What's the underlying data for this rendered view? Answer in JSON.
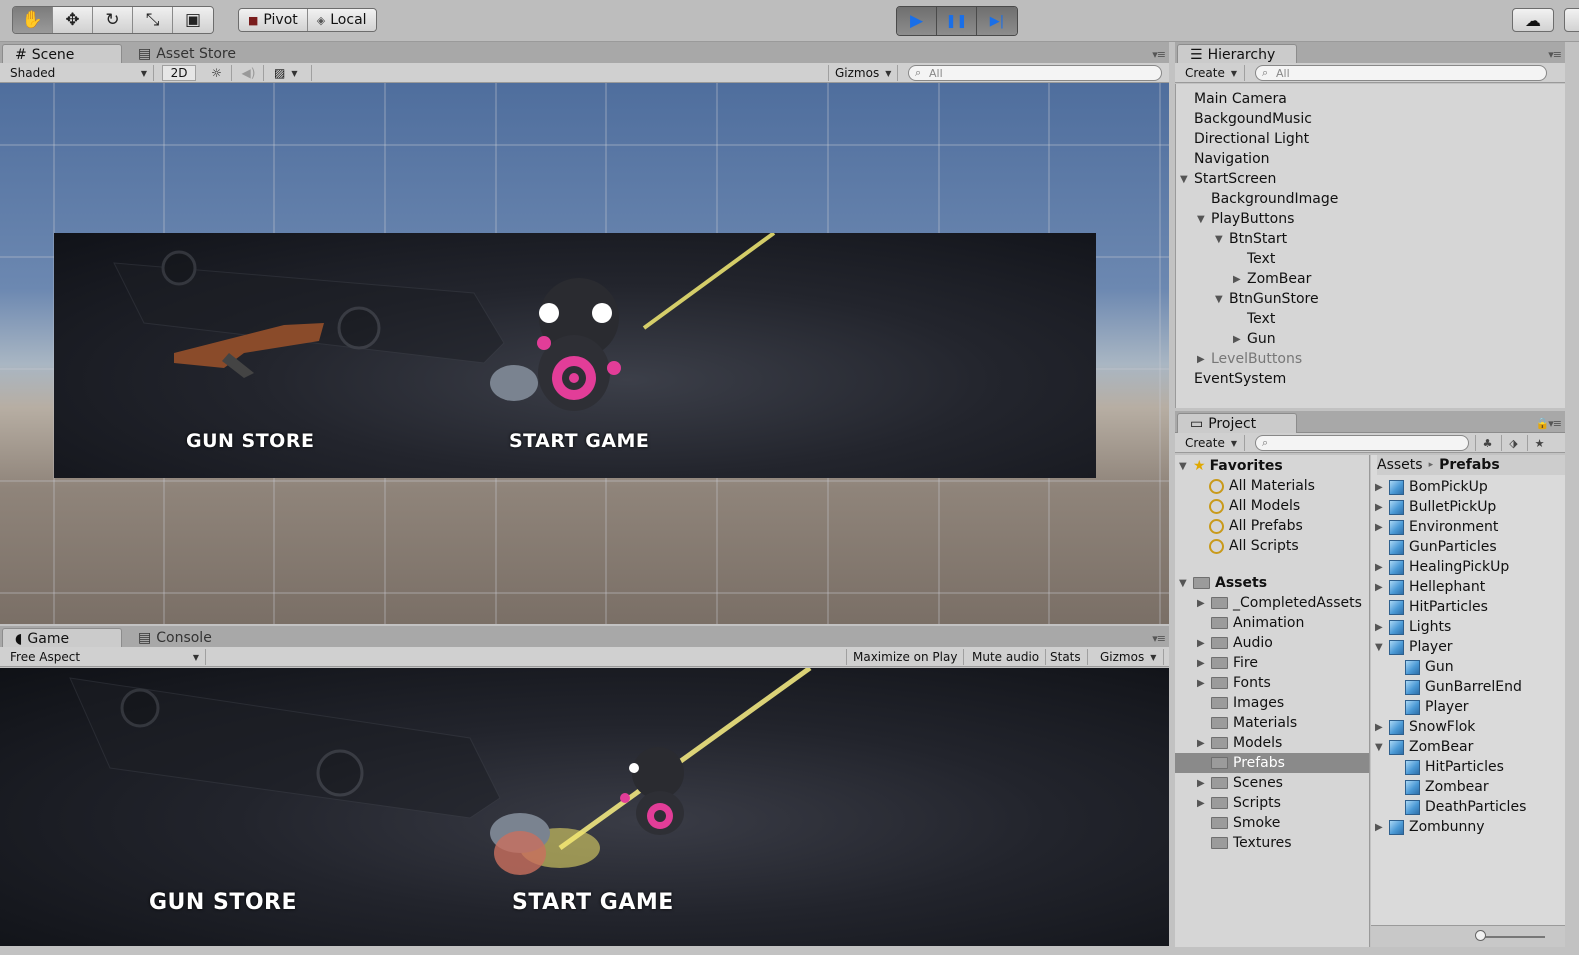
{
  "toolbar": {
    "tools": [
      {
        "name": "hand-tool",
        "glyph": "✋"
      },
      {
        "name": "move-tool",
        "glyph": "✥"
      },
      {
        "name": "rotate-tool",
        "glyph": "↻"
      },
      {
        "name": "scale-tool",
        "glyph": "⤡"
      },
      {
        "name": "rect-tool",
        "glyph": "▣"
      }
    ],
    "pivot_label": "Pivot",
    "local_label": "Local",
    "play_glyph": "▶",
    "pause_glyph": "❚❚",
    "step_glyph": "▶|",
    "cloud_glyph": "☁"
  },
  "scene": {
    "tab_label": "Scene",
    "asset_store_label": "Asset Store",
    "shading_mode": "Shaded",
    "mode_2d": "2D",
    "gizmos_label": "Gizmos",
    "search_placeholder": "All"
  },
  "game": {
    "tab_label": "Game",
    "console_label": "Console",
    "aspect": "Free Aspect",
    "maximize_label": "Maximize on Play",
    "mute_label": "Mute audio",
    "stats_label": "Stats",
    "gizmos_label": "Gizmos"
  },
  "canvas_labels": {
    "gun_store": "GUN STORE",
    "start_game": "START GAME"
  },
  "hierarchy": {
    "tab_label": "Hierarchy",
    "create_label": "Create",
    "search_placeholder": "All",
    "items": [
      {
        "label": "Main Camera",
        "expander": ""
      },
      {
        "label": "BackgoundMusic",
        "expander": ""
      },
      {
        "label": "Directional Light",
        "expander": ""
      },
      {
        "label": "Navigation",
        "expander": ""
      },
      {
        "label": "StartScreen",
        "expander": "▼"
      },
      {
        "label": "BackgroundImage",
        "expander": ""
      },
      {
        "label": "PlayButtons",
        "expander": "▼"
      },
      {
        "label": "BtnStart",
        "expander": "▼"
      },
      {
        "label": "Text",
        "expander": ""
      },
      {
        "label": "ZomBear",
        "expander": "▶"
      },
      {
        "label": "BtnGunStore",
        "expander": "▼"
      },
      {
        "label": "Text",
        "expander": ""
      },
      {
        "label": "Gun",
        "expander": "▶"
      },
      {
        "label": "LevelButtons",
        "expander": "▶"
      },
      {
        "label": "EventSystem",
        "expander": ""
      }
    ]
  },
  "project": {
    "tab_label": "Project",
    "create_label": "Create",
    "favorites_label": "Favorites",
    "favorites": [
      "All Materials",
      "All Models",
      "All Prefabs",
      "All Scripts"
    ],
    "assets_label": "Assets",
    "folders": [
      {
        "label": "_CompletedAssets",
        "expander": "▶"
      },
      {
        "label": "Animation",
        "expander": ""
      },
      {
        "label": "Audio",
        "expander": "▶"
      },
      {
        "label": "Fire",
        "expander": "▶"
      },
      {
        "label": "Fonts",
        "expander": "▶"
      },
      {
        "label": "Images",
        "expander": ""
      },
      {
        "label": "Materials",
        "expander": ""
      },
      {
        "label": "Models",
        "expander": "▶"
      },
      {
        "label": "Prefabs",
        "expander": ""
      },
      {
        "label": "Scenes",
        "expander": "▶"
      },
      {
        "label": "Scripts",
        "expander": "▶"
      },
      {
        "label": "Smoke",
        "expander": ""
      },
      {
        "label": "Textures",
        "expander": ""
      }
    ],
    "breadcrumb_root": "Assets",
    "breadcrumb_sep": "▸",
    "breadcrumb_current": "Prefabs",
    "prefabs": [
      {
        "label": "BomPickUp",
        "expander": "▶"
      },
      {
        "label": "BulletPickUp",
        "expander": "▶"
      },
      {
        "label": "Environment",
        "expander": "▶"
      },
      {
        "label": "GunParticles",
        "expander": ""
      },
      {
        "label": "HealingPickUp",
        "expander": "▶"
      },
      {
        "label": "Hellephant",
        "expander": "▶"
      },
      {
        "label": "HitParticles",
        "expander": ""
      },
      {
        "label": "Lights",
        "expander": "▶"
      },
      {
        "label": "Player",
        "expander": "▼"
      },
      {
        "label": "Gun",
        "expander": ""
      },
      {
        "label": "GunBarrelEnd",
        "expander": ""
      },
      {
        "label": "Player",
        "expander": ""
      },
      {
        "label": "SnowFlok",
        "expander": "▶"
      },
      {
        "label": "ZomBear",
        "expander": "▼"
      },
      {
        "label": "HitParticles",
        "expander": ""
      },
      {
        "label": "Zombear",
        "expander": ""
      },
      {
        "label": "DeathParticles",
        "expander": ""
      },
      {
        "label": "Zombunny",
        "expander": "▶"
      }
    ]
  },
  "colors": {
    "play_accent": "#1a6fe8",
    "selection": "#8a8a8a",
    "prefab_blue": "#4c9ad6",
    "favorites_star": "#e0a800"
  }
}
